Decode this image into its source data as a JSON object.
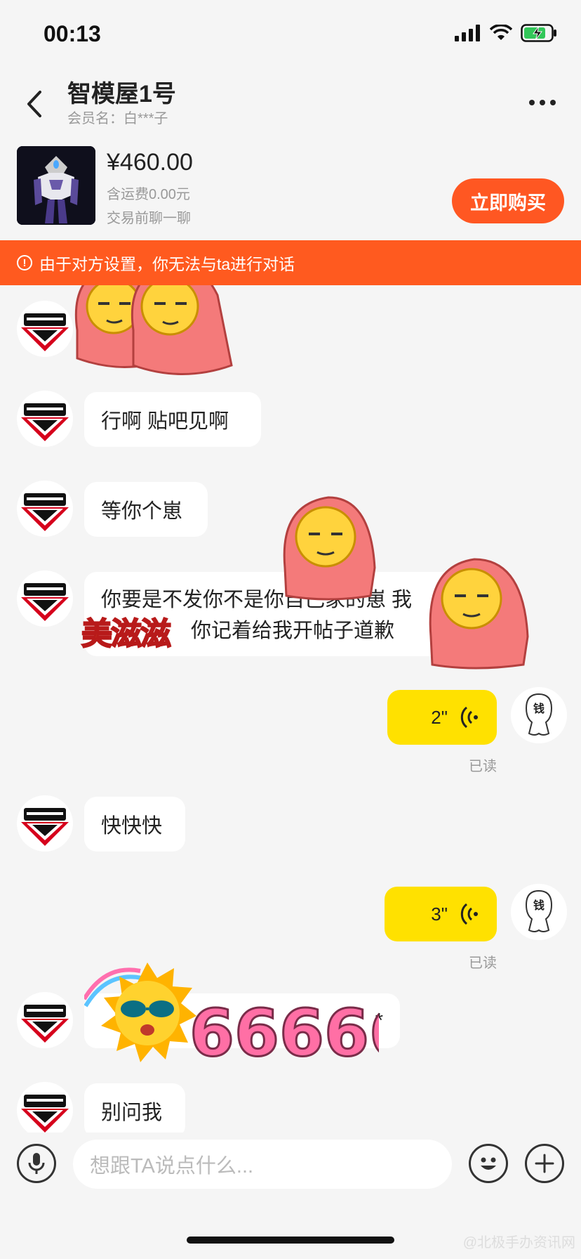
{
  "status_bar": {
    "time": "00:13"
  },
  "header": {
    "title": "智模屋1号",
    "member": "会员名：白***子"
  },
  "product": {
    "price": "¥460.00",
    "shipping": "含运费0.00元",
    "chat_hint": "交易前聊一聊",
    "buy_label": "立即购买"
  },
  "notice": {
    "text": "由于对方设置，你无法与ta进行对话"
  },
  "messages": {
    "m1": "行啊 贴吧见啊",
    "m2": "等你个崽",
    "m3_line1": "你要是不发你不是你自己家的崽 我",
    "m3_line2": "你记着给我开帖子道歉",
    "voice1": "2\"",
    "read1": "已读",
    "m4": "快快快",
    "voice2": "3\"",
    "read2": "已读",
    "m5": "*",
    "m6": "别问我"
  },
  "stickers": {
    "meizizi": "美滋滋",
    "six": "66666"
  },
  "self_avatar_text": "钱",
  "input": {
    "placeholder": "想跟TA说点什么..."
  },
  "watermark": "@北极手办资讯网",
  "colors": {
    "accent": "#ff5722",
    "voice_bubble": "#ffe100",
    "notice": "#ff5a1f"
  }
}
